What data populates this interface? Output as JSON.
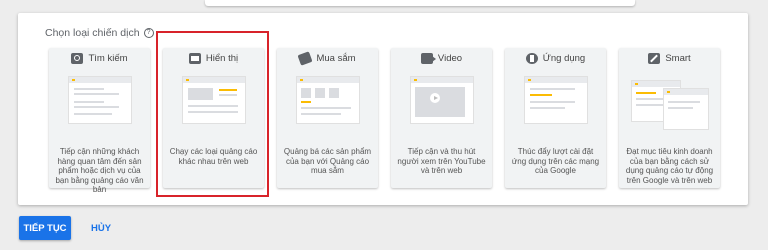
{
  "panel": {
    "title": "Chọn loại chiến dịch"
  },
  "cards": [
    {
      "title": "Tìm kiếm",
      "icon": "search-icon",
      "desc": "Tiếp cận những khách hàng quan tâm đến sản phẩm hoặc dịch vụ của bạn bằng quảng cáo văn bản"
    },
    {
      "title": "Hiển thị",
      "icon": "display-icon",
      "desc": "Chạy các loại quảng cáo khác nhau trên web"
    },
    {
      "title": "Mua sắm",
      "icon": "tag-icon",
      "desc": "Quảng bá các sản phẩm của bạn với Quảng cáo mua sắm"
    },
    {
      "title": "Video",
      "icon": "video-icon",
      "desc": "Tiếp cận và thu hút người xem trên YouTube và trên web"
    },
    {
      "title": "Ứng dụng",
      "icon": "app-icon",
      "desc": "Thúc đẩy lượt cài đặt ứng dụng trên các mạng của Google"
    },
    {
      "title": "Smart",
      "icon": "magic-wand-icon",
      "desc": "Đạt mục tiêu kinh doanh của bạn bằng cách sử dụng quảng cáo tự động trên Google và trên web"
    }
  ],
  "actions": {
    "continue_label": "TIẾP TỤC",
    "cancel_label": "HỦY"
  },
  "colors": {
    "primary": "#1a73e8",
    "highlight": "#d8232a",
    "accent": "#fbbc04"
  }
}
